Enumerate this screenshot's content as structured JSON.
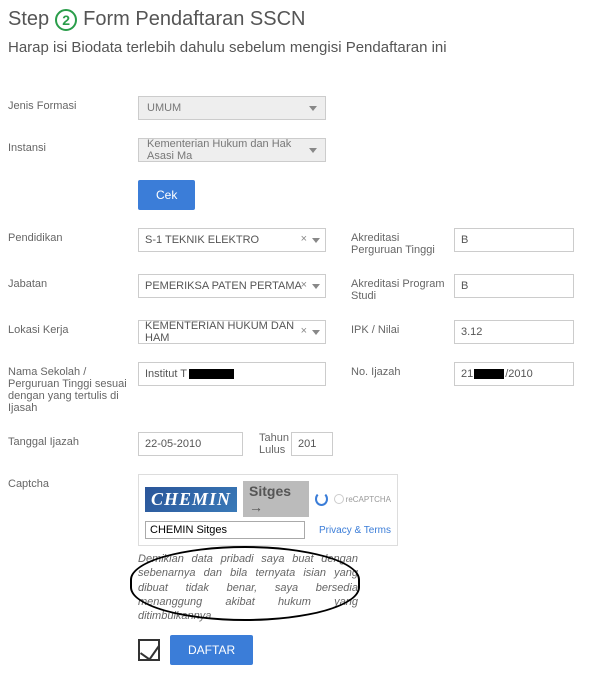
{
  "header": {
    "step_prefix": "Step",
    "step_number": "2",
    "title": "Form Pendaftaran SSCN",
    "subtitle": "Harap isi Biodata terlebih dahulu sebelum mengisi Pendaftaran ini"
  },
  "labels": {
    "jenis_formasi": "Jenis Formasi",
    "instansi": "Instansi",
    "pendidikan": "Pendidikan",
    "jabatan": "Jabatan",
    "lokasi_kerja": "Lokasi Kerja",
    "nama_sekolah": "Nama Sekolah / Perguruan Tinggi sesuai dengan yang tertulis di Ijasah",
    "tanggal_ijazah": "Tanggal Ijazah",
    "tahun_lulus": "Tahun Lulus",
    "captcha": "Captcha",
    "akreditasi_pt": "Akreditasi Perguruan Tinggi",
    "akreditasi_ps": "Akreditasi Program Studi",
    "ipk": "IPK / Nilai",
    "no_ijazah": "No. Ijazah"
  },
  "values": {
    "jenis_formasi": "UMUM",
    "instansi": "Kementerian Hukum dan Hak Asasi Ma",
    "pendidikan": "S-1 TEKNIK ELEKTRO",
    "jabatan": "PEMERIKSA PATEN PERTAMA",
    "lokasi_kerja": "KEMENTERIAN HUKUM DAN HAM",
    "nama_sekolah": "Institut T",
    "tanggal_ijazah": "22-05-2010",
    "tahun_lulus": "201",
    "akreditasi_pt": "B",
    "akreditasi_ps": "B",
    "ipk": "3.12",
    "no_ijazah_pre": "21",
    "no_ijazah_post": "/2010",
    "captcha_img1": "CHEMIN",
    "captcha_img2": "Sitges →",
    "captcha_input": "CHEMIN Sitges"
  },
  "buttons": {
    "cek": "Cek",
    "daftar": "DAFTAR"
  },
  "captcha": {
    "recaptcha_label": "reCAPTCHA",
    "privacy_terms": "Privacy & Terms"
  },
  "declaration": "Demikian data pribadi saya buat dengan sebenarnya dan bila ternyata isian yang dibuat tidak benar, saya bersedia menanggung akibat hukum yang ditimbulkannya"
}
